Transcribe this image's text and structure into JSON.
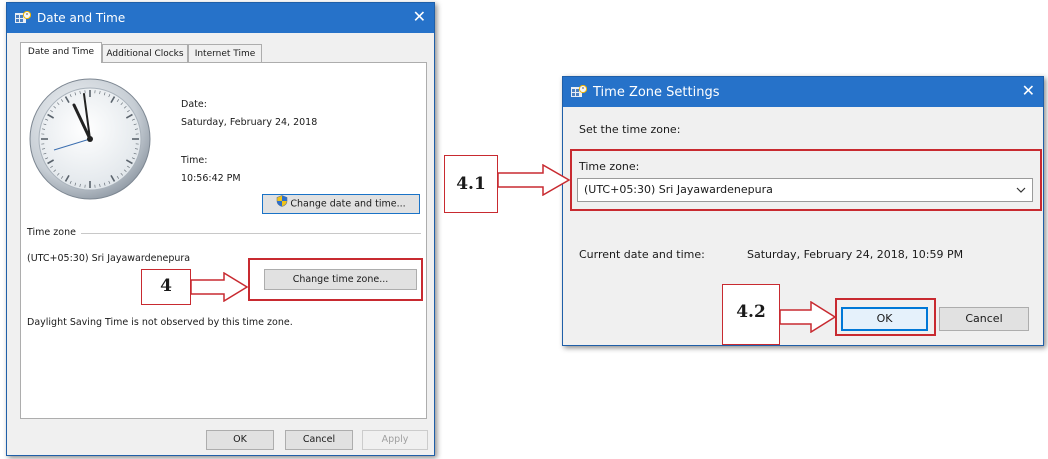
{
  "dialog1": {
    "title": "Date and Time",
    "close_glyph": "✕",
    "tabs": [
      "Date and Time",
      "Additional Clocks",
      "Internet Time"
    ],
    "date_label": "Date:",
    "date_value": "Saturday, February 24, 2018",
    "time_label": "Time:",
    "time_value": "10:56:42 PM",
    "change_date_button": "Change date and time...",
    "timezone_heading": "Time zone",
    "timezone_value": "(UTC+05:30) Sri Jayawardenepura",
    "change_tz_button": "Change time zone...",
    "dst_text": "Daylight Saving Time is not observed by this time zone.",
    "ok_button": "OK",
    "cancel_button": "Cancel",
    "apply_button": "Apply"
  },
  "dialog2": {
    "title": "Time Zone Settings",
    "close_glyph": "✕",
    "instruction": "Set the time zone:",
    "timezone_label": "Time zone:",
    "timezone_selected": "(UTC+05:30) Sri Jayawardenepura",
    "current_label": "Current date and time:",
    "current_value": "Saturday, February 24, 2018, 10:59 PM",
    "ok_button": "OK",
    "cancel_button": "Cancel"
  },
  "callouts": {
    "step_4": "4",
    "step_4_1": "4.1",
    "step_4_2": "4.2"
  },
  "icons": {
    "window_icon": "date-time-control-panel-icon",
    "uac_shield": "uac-shield-icon",
    "dropdown": "chevron-down-icon"
  },
  "colors": {
    "titlebar": "#2672c9",
    "highlight": "#c82a30"
  }
}
